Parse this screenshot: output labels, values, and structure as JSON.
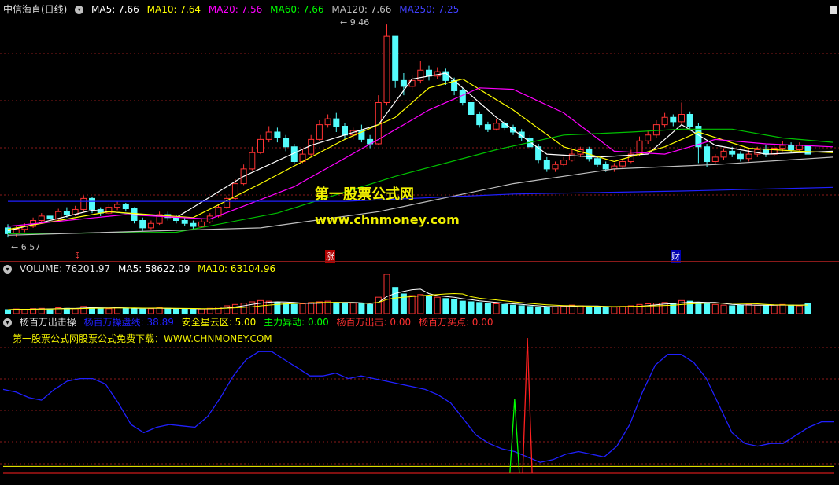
{
  "colors": {
    "bg": "#000000",
    "up": "#ff3333",
    "down": "#54fcfc",
    "ma5": "#ffffff",
    "ma10": "#ffff00",
    "ma20": "#ff00ff",
    "ma60": "#00c000",
    "ma120": "#c0c0c0",
    "ma250": "#2020ff",
    "grid": "#8b1a1a"
  },
  "price_legend": {
    "title": "中信海直(日线)",
    "ma5": "MA5: 7.66",
    "ma10": "MA10: 7.64",
    "ma20": "MA20: 7.56",
    "ma60": "MA60: 7.66",
    "ma120": "MA120: 7.66",
    "ma250": "MA250: 7.25"
  },
  "price_marks": {
    "high": "9.46",
    "low": "6.57"
  },
  "event_markers": {
    "m1": "$",
    "m2": "涨",
    "m3": "财"
  },
  "watermark": {
    "title": "第一股票公式网",
    "url": "www.chnmoney.com"
  },
  "volume_legend": {
    "volume": "VOLUME: 76201.97",
    "ma5": "MA5: 58622.09",
    "ma10": "MA10: 63104.96"
  },
  "indicator_legend": {
    "name": "杨百万出击操",
    "line1": "杨百万操盘线: 38.89",
    "line2": "安全星云区: 5.00",
    "line3": "主力异动: 0.00",
    "line4": "杨百万出击: 0.00",
    "line5": "杨百万买点: 0.00"
  },
  "promo": "第一股票公式网股票公式免费下载：WWW.CHNMONEY.COM",
  "chart_data": {
    "type": "candlestick",
    "price_range": [
      6.4,
      9.6
    ],
    "candles": [
      [
        6.7,
        6.62,
        6.75,
        6.57
      ],
      [
        6.62,
        6.68,
        6.72,
        6.58
      ],
      [
        6.68,
        6.72,
        6.76,
        6.64
      ],
      [
        6.72,
        6.8,
        6.84,
        6.7
      ],
      [
        6.8,
        6.86,
        6.9,
        6.76
      ],
      [
        6.86,
        6.82,
        6.9,
        6.78
      ],
      [
        6.82,
        6.92,
        6.96,
        6.8
      ],
      [
        6.92,
        6.88,
        6.98,
        6.84
      ],
      [
        6.88,
        6.95,
        7.0,
        6.86
      ],
      [
        6.95,
        7.1,
        7.14,
        6.92
      ],
      [
        7.1,
        6.95,
        7.12,
        6.9
      ],
      [
        6.95,
        6.9,
        6.98,
        6.86
      ],
      [
        6.9,
        6.98,
        7.02,
        6.88
      ],
      [
        6.98,
        7.02,
        7.06,
        6.94
      ],
      [
        7.02,
        6.96,
        7.04,
        6.92
      ],
      [
        6.96,
        6.8,
        6.98,
        6.76
      ],
      [
        6.8,
        6.7,
        6.84,
        6.66
      ],
      [
        6.7,
        6.76,
        6.8,
        6.68
      ],
      [
        6.76,
        6.88,
        6.92,
        6.74
      ],
      [
        6.88,
        6.84,
        6.92,
        6.8
      ],
      [
        6.84,
        6.8,
        6.88,
        6.76
      ],
      [
        6.8,
        6.76,
        6.84,
        6.72
      ],
      [
        6.76,
        6.72,
        6.8,
        6.68
      ],
      [
        6.72,
        6.78,
        6.82,
        6.7
      ],
      [
        6.78,
        6.86,
        6.9,
        6.76
      ],
      [
        6.86,
        6.98,
        7.02,
        6.84
      ],
      [
        6.98,
        7.1,
        7.14,
        6.96
      ],
      [
        7.1,
        7.3,
        7.36,
        7.08
      ],
      [
        7.3,
        7.5,
        7.56,
        7.28
      ],
      [
        7.5,
        7.72,
        7.8,
        7.48
      ],
      [
        7.72,
        7.9,
        7.96,
        7.7
      ],
      [
        7.9,
        8.0,
        8.08,
        7.86
      ],
      [
        8.0,
        7.92,
        8.06,
        7.86
      ],
      [
        7.92,
        7.8,
        7.96,
        7.74
      ],
      [
        7.8,
        7.6,
        7.84,
        7.56
      ],
      [
        7.6,
        7.7,
        7.76,
        7.58
      ],
      [
        7.7,
        7.9,
        7.96,
        7.68
      ],
      [
        7.9,
        8.1,
        8.16,
        7.88
      ],
      [
        8.1,
        8.18,
        8.24,
        8.06
      ],
      [
        8.18,
        8.08,
        8.26,
        8.0
      ],
      [
        8.08,
        7.96,
        8.12,
        7.9
      ],
      [
        7.96,
        8.02,
        8.06,
        7.9
      ],
      [
        8.02,
        7.9,
        8.1,
        7.86
      ],
      [
        7.9,
        7.84,
        7.96,
        7.78
      ],
      [
        7.84,
        8.4,
        8.5,
        7.82
      ],
      [
        8.4,
        9.3,
        9.46,
        8.36
      ],
      [
        9.3,
        8.7,
        9.2,
        8.6
      ],
      [
        8.7,
        8.62,
        8.8,
        8.5
      ],
      [
        8.62,
        8.7,
        8.78,
        8.56
      ],
      [
        8.7,
        8.84,
        8.96,
        8.66
      ],
      [
        8.84,
        8.76,
        8.9,
        8.7
      ],
      [
        8.76,
        8.82,
        8.88,
        8.72
      ],
      [
        8.82,
        8.7,
        8.86,
        8.64
      ],
      [
        8.7,
        8.56,
        8.74,
        8.5
      ],
      [
        8.56,
        8.4,
        8.6,
        8.36
      ],
      [
        8.4,
        8.24,
        8.44,
        8.2
      ],
      [
        8.24,
        8.1,
        8.28,
        8.06
      ],
      [
        8.1,
        8.04,
        8.14,
        8.0
      ],
      [
        8.04,
        8.12,
        8.18,
        8.02
      ],
      [
        8.12,
        8.06,
        8.16,
        8.02
      ],
      [
        8.06,
        8.0,
        8.1,
        7.96
      ],
      [
        8.0,
        7.92,
        8.04,
        7.88
      ],
      [
        7.92,
        7.8,
        7.96,
        7.76
      ],
      [
        7.8,
        7.62,
        7.84,
        7.58
      ],
      [
        7.62,
        7.5,
        7.66,
        7.46
      ],
      [
        7.5,
        7.56,
        7.6,
        7.46
      ],
      [
        7.56,
        7.62,
        7.66,
        7.54
      ],
      [
        7.62,
        7.7,
        7.76,
        7.6
      ],
      [
        7.7,
        7.76,
        7.8,
        7.66
      ],
      [
        7.76,
        7.64,
        7.8,
        7.6
      ],
      [
        7.64,
        7.56,
        7.68,
        7.52
      ],
      [
        7.56,
        7.5,
        7.6,
        7.46
      ],
      [
        7.5,
        7.54,
        7.58,
        7.46
      ],
      [
        7.54,
        7.6,
        7.64,
        7.5
      ],
      [
        7.6,
        7.7,
        7.76,
        7.58
      ],
      [
        7.7,
        7.88,
        7.94,
        7.68
      ],
      [
        7.88,
        7.96,
        8.02,
        7.84
      ],
      [
        7.96,
        8.1,
        8.16,
        7.92
      ],
      [
        8.1,
        8.2,
        8.26,
        8.06
      ],
      [
        8.2,
        8.14,
        8.24,
        8.08
      ],
      [
        8.14,
        8.24,
        8.4,
        8.1
      ],
      [
        8.24,
        8.08,
        8.28,
        8.02
      ],
      [
        8.08,
        7.8,
        8.12,
        7.58
      ],
      [
        7.8,
        7.6,
        7.84,
        7.52
      ],
      [
        7.6,
        7.66,
        7.7,
        7.56
      ],
      [
        7.66,
        7.74,
        7.78,
        7.62
      ],
      [
        7.74,
        7.7,
        7.8,
        7.66
      ],
      [
        7.7,
        7.64,
        7.74,
        7.6
      ],
      [
        7.64,
        7.7,
        7.76,
        7.6
      ],
      [
        7.7,
        7.76,
        7.8,
        7.66
      ],
      [
        7.76,
        7.7,
        7.82,
        7.66
      ],
      [
        7.7,
        7.78,
        7.84,
        7.68
      ],
      [
        7.78,
        7.82,
        7.88,
        7.74
      ],
      [
        7.82,
        7.76,
        7.86,
        7.72
      ],
      [
        7.76,
        7.82,
        7.86,
        7.72
      ],
      [
        7.82,
        7.7,
        7.84,
        7.66
      ]
    ],
    "ma_lines": {
      "ma5": [
        [
          0,
          6.66
        ],
        [
          10,
          6.94
        ],
        [
          20,
          6.84
        ],
        [
          28,
          7.4
        ],
        [
          36,
          7.82
        ],
        [
          44,
          8.1
        ],
        [
          48,
          8.72
        ],
        [
          52,
          8.8
        ],
        [
          58,
          8.2
        ],
        [
          64,
          7.7
        ],
        [
          70,
          7.66
        ],
        [
          76,
          7.7
        ],
        [
          80,
          8.1
        ],
        [
          84,
          7.82
        ],
        [
          90,
          7.7
        ],
        [
          98,
          7.74
        ]
      ],
      "ma10": [
        [
          0,
          6.68
        ],
        [
          12,
          6.92
        ],
        [
          22,
          6.84
        ],
        [
          30,
          7.3
        ],
        [
          40,
          7.9
        ],
        [
          46,
          8.2
        ],
        [
          50,
          8.6
        ],
        [
          54,
          8.72
        ],
        [
          60,
          8.3
        ],
        [
          66,
          7.8
        ],
        [
          72,
          7.6
        ],
        [
          78,
          7.8
        ],
        [
          82,
          8.0
        ],
        [
          88,
          7.78
        ],
        [
          94,
          7.74
        ],
        [
          98,
          7.72
        ]
      ],
      "ma20": [
        [
          0,
          6.72
        ],
        [
          14,
          6.88
        ],
        [
          24,
          6.82
        ],
        [
          34,
          7.26
        ],
        [
          44,
          7.9
        ],
        [
          50,
          8.3
        ],
        [
          56,
          8.6
        ],
        [
          60,
          8.58
        ],
        [
          66,
          8.26
        ],
        [
          72,
          7.74
        ],
        [
          78,
          7.7
        ],
        [
          84,
          7.9
        ],
        [
          90,
          7.84
        ],
        [
          98,
          7.8
        ]
      ],
      "ma60": [
        [
          0,
          6.62
        ],
        [
          20,
          6.64
        ],
        [
          32,
          6.9
        ],
        [
          46,
          7.4
        ],
        [
          58,
          7.76
        ],
        [
          66,
          7.96
        ],
        [
          74,
          8.0
        ],
        [
          80,
          8.04
        ],
        [
          86,
          8.04
        ],
        [
          92,
          7.92
        ],
        [
          98,
          7.86
        ]
      ],
      "ma120": [
        [
          0,
          6.6
        ],
        [
          30,
          6.7
        ],
        [
          44,
          6.92
        ],
        [
          60,
          7.3
        ],
        [
          72,
          7.5
        ],
        [
          84,
          7.56
        ],
        [
          98,
          7.66
        ]
      ],
      "ma250": [
        [
          0,
          7.06
        ],
        [
          40,
          7.06
        ],
        [
          60,
          7.16
        ],
        [
          80,
          7.2
        ],
        [
          98,
          7.25
        ]
      ]
    },
    "volume": [
      12,
      14,
      13,
      15,
      16,
      14,
      18,
      16,
      15,
      22,
      20,
      16,
      15,
      18,
      17,
      16,
      14,
      15,
      18,
      16,
      15,
      14,
      13,
      14,
      16,
      20,
      24,
      28,
      32,
      36,
      40,
      38,
      34,
      30,
      28,
      30,
      34,
      36,
      38,
      34,
      30,
      32,
      30,
      28,
      50,
      120,
      80,
      60,
      55,
      58,
      52,
      50,
      46,
      42,
      38,
      36,
      34,
      32,
      30,
      28,
      26,
      24,
      22,
      20,
      20,
      22,
      24,
      26,
      24,
      22,
      20,
      18,
      20,
      22,
      24,
      28,
      30,
      32,
      34,
      30,
      40,
      38,
      34,
      30,
      28,
      26,
      24,
      26,
      28,
      26,
      24,
      26,
      28,
      26,
      24,
      30
    ],
    "indicator": {
      "range": [
        0,
        100
      ],
      "yang_line": [
        62,
        60,
        56,
        54,
        62,
        68,
        70,
        70,
        66,
        52,
        36,
        30,
        34,
        36,
        35,
        34,
        42,
        56,
        72,
        84,
        90,
        90,
        84,
        78,
        72,
        72,
        74,
        70,
        72,
        70,
        68,
        66,
        64,
        62,
        58,
        52,
        40,
        28,
        22,
        18,
        16,
        12,
        8,
        10,
        14,
        16,
        14,
        12,
        20,
        36,
        60,
        80,
        88,
        88,
        82,
        70,
        50,
        30,
        22,
        20,
        22,
        22,
        28,
        34,
        38,
        38
      ]
    },
    "signal": {
      "red_peak_index": 41,
      "green_peak_index": 40
    }
  }
}
